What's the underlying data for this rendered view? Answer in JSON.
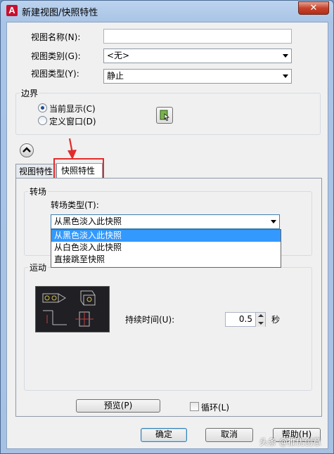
{
  "window": {
    "title": "新建视图/快照特性",
    "app_icon_glyph": "A",
    "close_glyph": "✕"
  },
  "view_name": {
    "label": "视图名称(N):",
    "value": ""
  },
  "view_category": {
    "label": "视图类别(G):",
    "value": "<无>"
  },
  "view_type": {
    "label": "视图类型(Y):",
    "value": "静止"
  },
  "boundary": {
    "title": "边界",
    "options": [
      "当前显示(C)",
      "定义窗口(D)"
    ],
    "selected_index": 0
  },
  "tabs": [
    "视图特性",
    "快照特性"
  ],
  "active_tab": 1,
  "transition": {
    "title": "转场",
    "type_label": "转场类型(T):",
    "value": "从黑色淡入此快照",
    "options": [
      "从黑色淡入此快照",
      "从白色淡入此快照",
      "直接跳至快照"
    ],
    "highlighted_index": 0
  },
  "motion": {
    "title": "运动",
    "duration_label": "持续时间(U):",
    "duration_value": "0.5",
    "duration_unit": "秒"
  },
  "preview_button": "预览(P)",
  "loop_checkbox": {
    "label": "循环(L)",
    "checked": false
  },
  "buttons": {
    "ok": "确定",
    "cancel": "取消",
    "help": "帮助(H)"
  },
  "watermark": "头条 @推优创意",
  "colors": {
    "annotation_red": "#e32b2b",
    "selection_blue": "#3399ff",
    "preview_bg": "#1f1f24"
  }
}
